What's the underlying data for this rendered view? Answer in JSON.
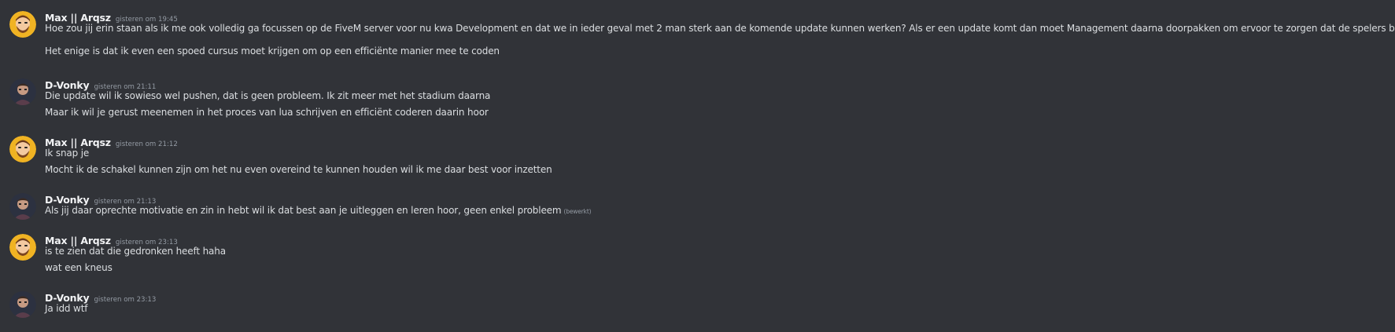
{
  "messages": [
    {
      "username": "Max || Arqsz",
      "timestamp": "gisteren om 19:45",
      "avatar_icon": "max-arqsz-avatar-icon",
      "lines": [
        "Hoe zou jij erin staan als ik me ook volledig ga focussen op de FiveM server voor nu kwa Development en dat we in ieder geval met 2 man sterk aan de komende update kunnen werken? Als er een update komt dan moet Management daarna doorpakken om ervoor te zorgen dat de spelers blijven.",
        "Het enige is dat ik even een spoed cursus moet krijgen om op een efficiënte manier mee te coden"
      ]
    },
    {
      "username": "D-Vonky",
      "timestamp": "gisteren om 21:11",
      "avatar_icon": "d-vonky-avatar-icon",
      "lines": [
        "Die update wil ik sowieso wel pushen, dat is geen probleem. Ik zit meer met het stadium daarna",
        "Maar ik wil je gerust meenemen in het proces van lua schrijven en efficiënt coderen daarin hoor"
      ]
    },
    {
      "username": "Max || Arqsz",
      "timestamp": "gisteren om 21:12",
      "avatar_icon": "max-arqsz-avatar-icon",
      "lines": [
        "Ik snap je",
        "Mocht ik de schakel kunnen zijn om het nu even overeind te kunnen houden wil ik me daar best voor inzetten"
      ]
    },
    {
      "username": "D-Vonky",
      "timestamp": "gisteren om 21:13",
      "avatar_icon": "d-vonky-avatar-icon",
      "lines": [
        "Als jij daar oprechte motivatie en zin in hebt  wil ik dat best aan je uitleggen en leren hoor, geen enkel probleem"
      ],
      "edited_label": "(bewerkt)"
    },
    {
      "username": "Max || Arqsz",
      "timestamp": "gisteren om 23:13",
      "avatar_icon": "max-arqsz-avatar-icon",
      "lines": [
        "is te zien dat die gedronken heeft haha",
        "wat een kneus"
      ]
    },
    {
      "username": "D-Vonky",
      "timestamp": "gisteren om 23:13",
      "avatar_icon": "d-vonky-avatar-icon",
      "lines": [
        "Ja idd wtf"
      ]
    }
  ],
  "colors": {
    "background": "#313338",
    "username": "#f2f3f5",
    "timestamp": "#949ba4",
    "text": "#dbdee1"
  }
}
